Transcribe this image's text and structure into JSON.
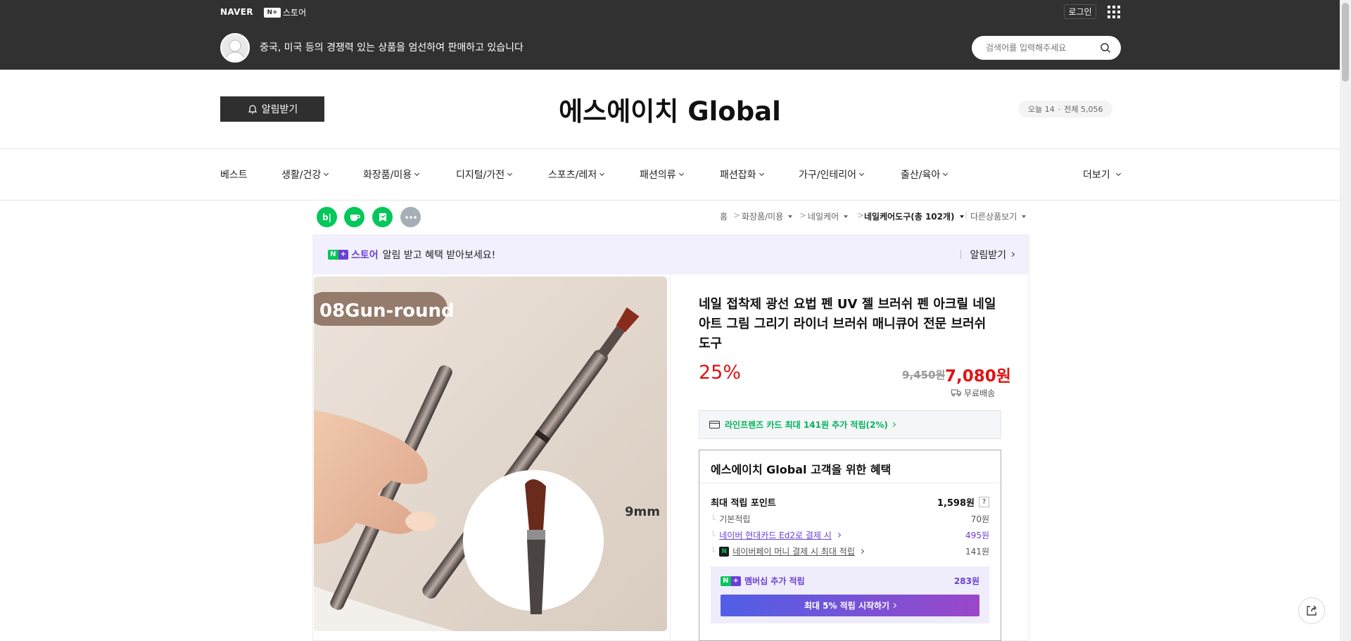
{
  "top": {
    "naver": "NAVER",
    "nstore": "스토어",
    "np_badge": "N+",
    "login": "로그인",
    "slogan": "중국, 미국 등의 경쟁력 있는 상품을 엄선하여 판매하고 있습니다",
    "search_placeholder": "검색어를 입력해주세요"
  },
  "store": {
    "notify_label": "알림받기",
    "title": "에스에이치 Global",
    "visits_today": "오늘 14",
    "visits_total": "전체 5,056"
  },
  "nav": {
    "items": [
      "베스트",
      "생활/건강",
      "화장품/미용",
      "디지털/가전",
      "스포츠/레저",
      "패션의류",
      "패션잡화",
      "가구/인테리어",
      "출산/육아"
    ],
    "more": "더보기"
  },
  "share": {
    "blog": "b|"
  },
  "breadcrumb": {
    "home": "홈",
    "c1": "화장품/미용",
    "c2": "네일케어",
    "c3": "네일케어도구(총 102개)",
    "other": "다른상품보기"
  },
  "banner": {
    "store_label": "스토어",
    "text": "알림 받고 혜택 받아보세요!",
    "action": "알림받기"
  },
  "image": {
    "tag": "08Gun-round",
    "size": "9mm"
  },
  "product": {
    "title": "네일 접착제 광선 요법 펜 UV 젤 브러쉬 펜 아크릴 네일 아트 그림 그리기 라이너 브러쉬 매니큐어 전문 브러쉬 도구",
    "discount": "25%",
    "original_price": "9,450원",
    "price": "7,080원",
    "shipping": "무료배송",
    "card_benefit": "라인프렌즈 카드 최대 141원 추가 적립(2%)"
  },
  "benefit": {
    "title": "에스에이치 Global 고객을 위한 혜택",
    "max_label": "최대 적립 포인트",
    "max_value": "1,598원",
    "help": "?",
    "rows": [
      {
        "label": "기본적립",
        "value": "70원"
      },
      {
        "label": "네이버 현대카드 Ed2로 결제 시",
        "value": "495원"
      },
      {
        "label": "네이버페이 머니 결제 시 최대 적립",
        "value": "141원"
      }
    ],
    "member_label": "멤버십 추가 적립",
    "member_value": "283원",
    "start_button": "최대 5% 적립 시작하기"
  },
  "colors": {
    "topbar": "#313131",
    "accent_red": "#e01212",
    "naver_green": "#03c75a",
    "purple": "#6b3fd6"
  }
}
